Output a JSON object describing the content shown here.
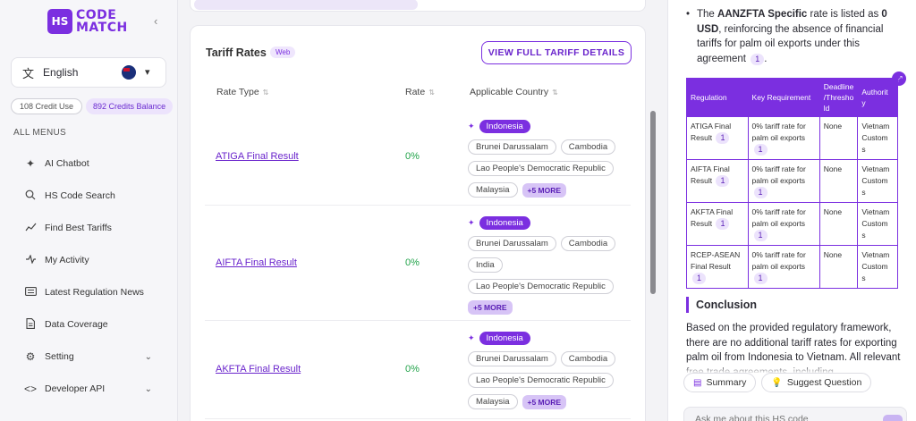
{
  "brand": {
    "logo_mark": "HS",
    "logo_line1": "CODE",
    "logo_line2": "MATCH"
  },
  "sidebar": {
    "collapse_icon": "‹",
    "language": "English",
    "credits": {
      "used": "108 Credit Use",
      "balance": "892 Credits Balance"
    },
    "menus_heading": "ALL MENUS",
    "items": [
      {
        "label": "AI Chatbot",
        "icon": "sparkle-icon"
      },
      {
        "label": "HS Code Search",
        "icon": "search-icon"
      },
      {
        "label": "Find Best Tariffs",
        "icon": "trend-icon"
      },
      {
        "label": "My Activity",
        "icon": "activity-icon"
      },
      {
        "label": "Latest Regulation News",
        "icon": "news-icon"
      },
      {
        "label": "Data Coverage",
        "icon": "document-icon"
      },
      {
        "label": "Setting",
        "icon": "gear-icon"
      },
      {
        "label": "Developer API",
        "icon": "code-icon"
      }
    ]
  },
  "tariff_card": {
    "title": "Tariff Rates",
    "badge": "Web",
    "view_button": "VIEW FULL TARIFF DETAILS",
    "columns": {
      "rate_type": "Rate Type",
      "rate": "Rate",
      "country": "Applicable Country"
    },
    "rows": [
      {
        "name": "ATIGA Final Result",
        "rate": "0%",
        "highlight": "Indonesia",
        "countries": [
          "Brunei Darussalam",
          "Cambodia",
          "Lao People's Democratic Republic",
          "Malaysia"
        ],
        "more": "+5 MORE"
      },
      {
        "name": "AIFTA Final Result",
        "rate": "0%",
        "highlight": "Indonesia",
        "countries": [
          "Brunei Darussalam",
          "Cambodia",
          "India",
          "Lao People's Democratic Republic"
        ],
        "more": "+5 MORE"
      },
      {
        "name": "AKFTA Final Result",
        "rate": "0%",
        "highlight": "Indonesia",
        "countries": [
          "Brunei Darussalam",
          "Cambodia",
          "Lao People's Democratic Republic",
          "Malaysia"
        ],
        "more": "+5 MORE"
      }
    ]
  },
  "chat_panel": {
    "bullet": {
      "prefix": "The ",
      "bold1": "AANZFTA Specific",
      "mid": " rate is listed as ",
      "bold2": "0 USD",
      "suffix": ", reinforcing the absence of financial tariffs for palm oil exports under this agreement",
      "cite": "1",
      "end": "."
    },
    "table": {
      "headers": [
        "Regulation",
        "Key Requirement",
        "Deadline /Thresho ld",
        "Authorit y"
      ],
      "rows": [
        {
          "regulation": "ATIGA Final Result",
          "requirement": "0% tariff rate for palm oil exports",
          "deadline": "None",
          "authority": "Vietnam Custom s",
          "cite": "1"
        },
        {
          "regulation": "AIFTA Final Result",
          "requirement": "0% tariff rate for palm oil exports",
          "deadline": "None",
          "authority": "Vietnam Custom s",
          "cite": "1"
        },
        {
          "regulation": "AKFTA Final Result",
          "requirement": "0% tariff rate for palm oil exports",
          "deadline": "None",
          "authority": "Vietnam Custom s",
          "cite": "1"
        },
        {
          "regulation": "RCEP-ASEAN Final Result",
          "requirement": "0% tariff rate for palm oil exports",
          "deadline": "None",
          "authority": "Vietnam Custom s",
          "cite": "1"
        }
      ]
    },
    "conclusion_heading": "Conclusion",
    "conclusion_text": "Based on the provided regulatory framework, there are no additional tariff rates for exporting palm oil from Indonesia to Vietnam. All relevant free trade agreements, including",
    "summary_button": "Summary",
    "suggest_button": "Suggest Question",
    "ask_placeholder": "Ask me about this HS code"
  },
  "colors": {
    "accent": "#7b2fe0",
    "rate_green": "#22a34a"
  }
}
